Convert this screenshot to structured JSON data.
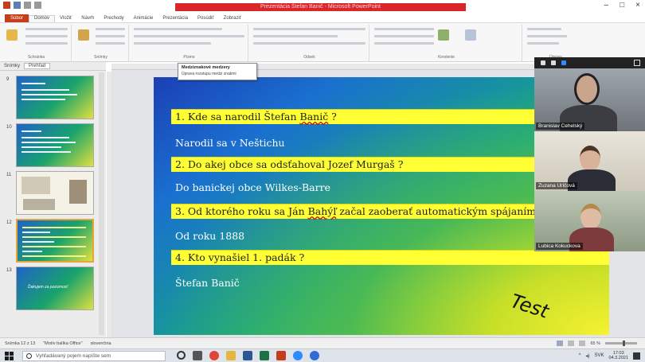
{
  "window": {
    "title": "Prezentácia Štefan Banič - Microsoft PowerPoint",
    "controls": [
      "–",
      "□",
      "×"
    ]
  },
  "ribbon": {
    "tabs": [
      "Súbor",
      "Domov",
      "Vložiť",
      "Návrh",
      "Prechody",
      "Animácie",
      "Prezentácia",
      "Posúdiť",
      "Zobraziť"
    ],
    "groups": [
      "Schránka",
      "Snímky",
      "Písmo",
      "Odsek",
      "Kreslenie",
      "Úpravy"
    ]
  },
  "tooltip": {
    "title": "Medziznakové medzery",
    "body": "Úprava rozstupu medzi znakmi"
  },
  "panel": {
    "tabs": [
      "Snímky",
      "Prehľad"
    ],
    "thumb_numbers": [
      "9",
      "10",
      "11",
      "12",
      "13"
    ],
    "thumb13_text": "Ďakujem za pozornosť"
  },
  "slide": {
    "questions": [
      {
        "pre": "1. Kde sa narodil Štefan ",
        "mark": "Banič",
        "post": " ?"
      },
      {
        "pre": "2. Do akej obce sa odsťahoval Jozef Murgaš ?",
        "mark": "",
        "post": ""
      },
      {
        "pre": "3. Od ktorého roku sa Ján ",
        "mark": "Bahýľ",
        "post": " začal zaoberať automatickým spájaním vlakových"
      },
      {
        "pre": "4. Kto vynašiel 1. padák ?",
        "mark": "",
        "post": ""
      }
    ],
    "answers": [
      "Narodil sa v Neštichu",
      "Do banickej obce Wilkes-Barre",
      "Od roku 1888",
      "Štefan Banič"
    ],
    "watermark": "Test"
  },
  "video_call": {
    "participants": [
      "Branislav Cehelský",
      "Zuzana Uríčová",
      "Lubica Kokuckova"
    ]
  },
  "statusbar": {
    "left": [
      "Snímka 12 z 13",
      "\"Motív balíka Office\"",
      "slovenčina"
    ],
    "zoom": "65 %"
  },
  "taskbar": {
    "search_placeholder": "Vyhľadávaný pojem napíšte sem",
    "time": "17:03",
    "date": "04.3.2021",
    "lang": "SVK"
  }
}
